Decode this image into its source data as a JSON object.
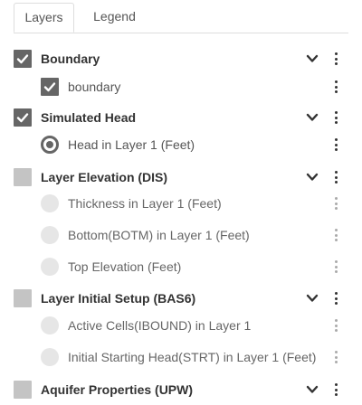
{
  "tabs": [
    {
      "label": "Layers",
      "active": true
    },
    {
      "label": "Legend",
      "active": false
    }
  ],
  "groups": [
    {
      "title": "Boundary",
      "checked": true,
      "items": [
        {
          "label": "boundary",
          "control": "checkbox",
          "checked": true
        }
      ]
    },
    {
      "title": "Simulated Head",
      "checked": true,
      "items": [
        {
          "label": "Head in Layer 1 (Feet)",
          "control": "radio",
          "selected": true
        }
      ]
    },
    {
      "title": "Layer Elevation (DIS)",
      "checked": false,
      "items": [
        {
          "label": "Thickness in Layer 1 (Feet)",
          "control": "radio",
          "selected": false
        },
        {
          "label": "Bottom(BOTM) in Layer 1 (Feet)",
          "control": "radio",
          "selected": false
        },
        {
          "label": "Top Elevation (Feet)",
          "control": "radio",
          "selected": false
        }
      ]
    },
    {
      "title": "Layer Initial Setup (BAS6)",
      "checked": false,
      "items": [
        {
          "label": "Active Cells(IBOUND) in Layer 1",
          "control": "radio",
          "selected": false
        },
        {
          "label": "Initial Starting Head(STRT) in Layer 1 (Feet)",
          "control": "radio",
          "selected": false
        }
      ]
    },
    {
      "title": "Aquifer Properties (UPW)",
      "checked": false,
      "items": []
    }
  ],
  "icons": {
    "expand": "chevron-down-icon",
    "more": "more-vertical-icon",
    "check": "check-icon"
  },
  "colors": {
    "checked_box": "#666666",
    "unchecked_box": "#c4c4c4",
    "radio_off": "#e6e6e6"
  }
}
